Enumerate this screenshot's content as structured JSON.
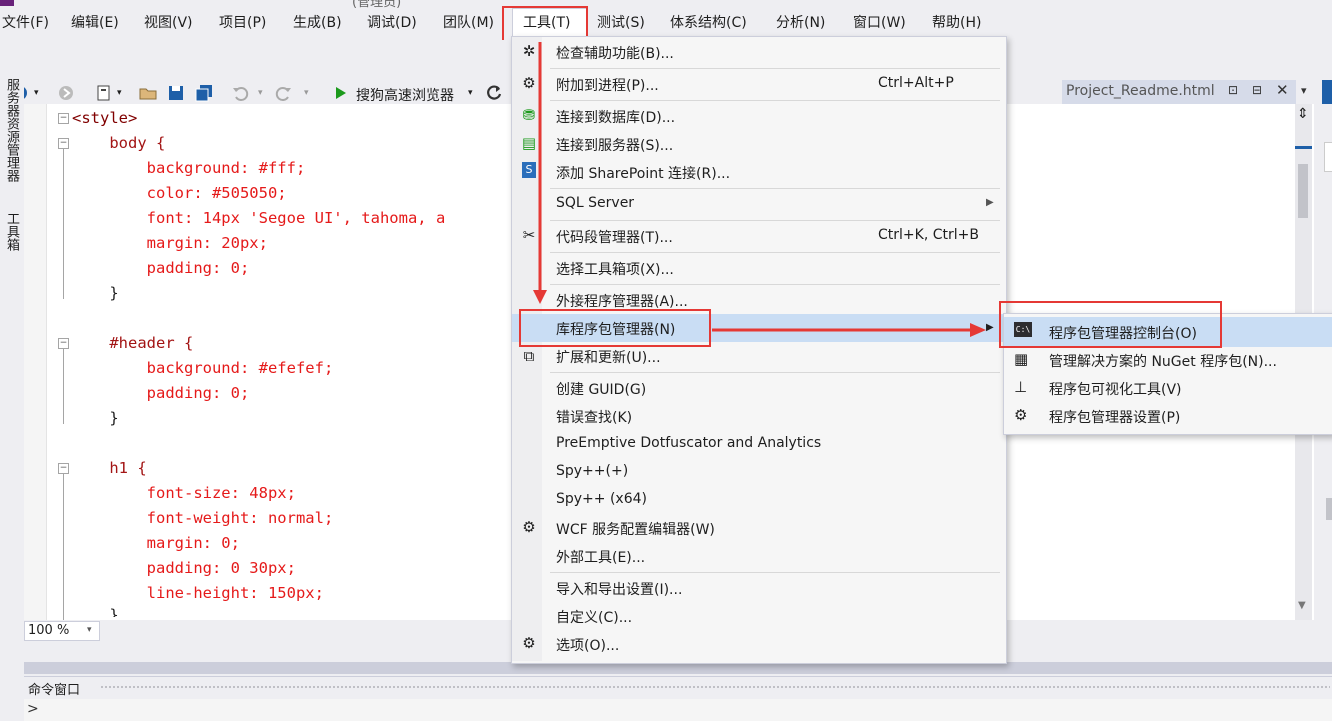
{
  "window_title_fragment": "(管理员)",
  "menubar": {
    "items": [
      "文件(F)",
      "编辑(E)",
      "视图(V)",
      "项目(P)",
      "生成(B)",
      "调试(D)",
      "团队(M)",
      "工具(T)",
      "测试(S)",
      "体系结构(C)",
      "分析(N)",
      "窗口(W)",
      "帮助(H)"
    ]
  },
  "toolbar": {
    "browser_label": "搜狗高速浏览器"
  },
  "left_strip": {
    "server_explorer": "服务器资源管理器",
    "toolbox": "工具箱"
  },
  "doc_tab": {
    "title": "Project_Readme.html"
  },
  "code_lines": [
    "<style>",
    "    body {",
    "        background: #fff;",
    "        color: #505050;",
    "        font: 14px 'Segoe UI', tahoma, a",
    "        margin: 20px;",
    "        padding: 0;",
    "    }",
    "",
    "    #header {",
    "        background: #efefef;",
    "        padding: 0;",
    "    }",
    "",
    "    h1 {",
    "        font-size: 48px;",
    "        font-weight: normal;",
    "        margin: 0;",
    "        padding: 0 30px;",
    "        line-height: 150px;",
    "    }"
  ],
  "zoom": "100 %",
  "tools_menu": {
    "items": [
      {
        "label": "检查辅助功能(B)...",
        "shortcut": "",
        "icon": "accessibility-icon"
      },
      {
        "label": "附加到进程(P)...",
        "shortcut": "Ctrl+Alt+P",
        "icon": "attach-process-icon"
      },
      {
        "label": "连接到数据库(D)...",
        "shortcut": "",
        "icon": "connect-database-icon"
      },
      {
        "label": "连接到服务器(S)...",
        "shortcut": "",
        "icon": "connect-server-icon"
      },
      {
        "label": "添加 SharePoint 连接(R)...",
        "shortcut": "",
        "icon": "sharepoint-icon"
      },
      {
        "label": "SQL Server",
        "shortcut": "",
        "icon": ""
      },
      {
        "label": "代码段管理器(T)...",
        "shortcut": "Ctrl+K, Ctrl+B",
        "icon": "snippet-icon"
      },
      {
        "label": "选择工具箱项(X)...",
        "shortcut": "",
        "icon": ""
      },
      {
        "label": "外接程序管理器(A)...",
        "shortcut": "",
        "icon": ""
      },
      {
        "label": "库程序包管理器(N)",
        "shortcut": "",
        "icon": ""
      },
      {
        "label": "扩展和更新(U)...",
        "shortcut": "",
        "icon": "extensions-icon"
      },
      {
        "label": "创建 GUID(G)",
        "shortcut": "",
        "icon": ""
      },
      {
        "label": "错误查找(K)",
        "shortcut": "",
        "icon": ""
      },
      {
        "label": "PreEmptive Dotfuscator and Analytics",
        "shortcut": "",
        "icon": ""
      },
      {
        "label": "Spy++(+)",
        "shortcut": "",
        "icon": ""
      },
      {
        "label": "Spy++ (x64)",
        "shortcut": "",
        "icon": ""
      },
      {
        "label": "WCF 服务配置编辑器(W)",
        "shortcut": "",
        "icon": "wcf-gear-icon"
      },
      {
        "label": "外部工具(E)...",
        "shortcut": "",
        "icon": ""
      },
      {
        "label": "导入和导出设置(I)...",
        "shortcut": "",
        "icon": ""
      },
      {
        "label": "自定义(C)...",
        "shortcut": "",
        "icon": ""
      },
      {
        "label": "选项(O)...",
        "shortcut": "",
        "icon": "options-gear-icon"
      }
    ]
  },
  "package_submenu": {
    "items": [
      {
        "label": "程序包管理器控制台(O)",
        "icon": "console-icon"
      },
      {
        "label": "管理解决方案的 NuGet 程序包(N)...",
        "icon": "nuget-icon"
      },
      {
        "label": "程序包可视化工具(V)",
        "icon": "hierarchy-icon"
      },
      {
        "label": "程序包管理器设置(P)",
        "icon": "settings-gear-icon"
      }
    ]
  },
  "command_window": {
    "title": "命令窗口",
    "prompt": ">"
  },
  "colors": {
    "accent_red": "#e53935",
    "highlight": "#c9ddf4",
    "css_property": "#e51a1a",
    "css_value": "#0000ff",
    "css_selector": "#a31515",
    "tag": "#800000"
  }
}
